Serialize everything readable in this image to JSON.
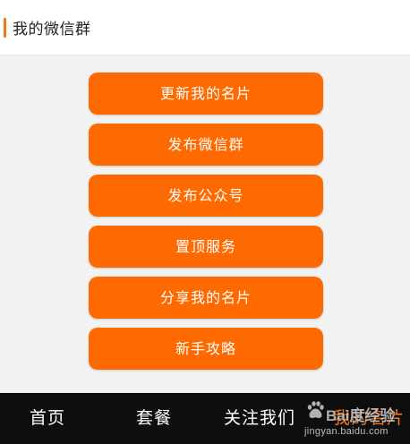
{
  "header": {
    "title": "我的微信群"
  },
  "menu": {
    "items": [
      {
        "label": "更新我的名片"
      },
      {
        "label": "发布微信群"
      },
      {
        "label": "发布公众号"
      },
      {
        "label": "置顶服务"
      },
      {
        "label": "分享我的名片"
      },
      {
        "label": "新手攻略"
      }
    ]
  },
  "tabbar": {
    "items": [
      {
        "label": "首页"
      },
      {
        "label": "套餐"
      },
      {
        "label": "关注我们"
      },
      {
        "label": "我的名片"
      }
    ],
    "active_index": 3
  },
  "watermark": {
    "brand": "Bai度经验",
    "url": "jingyan.baidu.com"
  },
  "colors": {
    "accent": "#ff6a00",
    "active_tab": "#ff7a1a",
    "tabbar_bg": "#0e0e0e"
  }
}
